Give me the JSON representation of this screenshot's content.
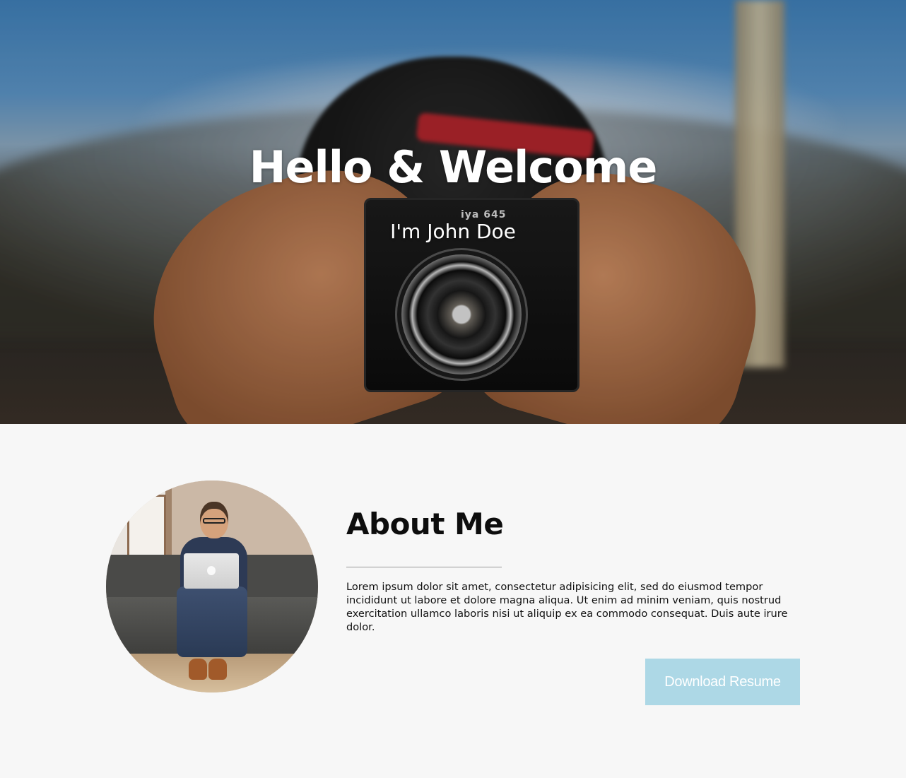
{
  "hero": {
    "title": "Hello & Welcome",
    "subtitle": "I'm John Doe",
    "camera_label": "iya 645"
  },
  "about": {
    "title": "About Me",
    "text": "Lorem ipsum dolor sit amet, consectetur adipisicing elit, sed do eiusmod tempor incididunt ut labore et dolore magna aliqua. Ut enim ad minim veniam, quis nostrud exercitation ullamco laboris nisi ut aliquip ex ea commodo consequat. Duis aute irure dolor.",
    "download_label": "Download Resume"
  },
  "colors": {
    "page_background": "#f7f7f7",
    "button_background": "#add8e6",
    "button_text": "#ffffff",
    "heading_text": "#0d0d0d"
  }
}
